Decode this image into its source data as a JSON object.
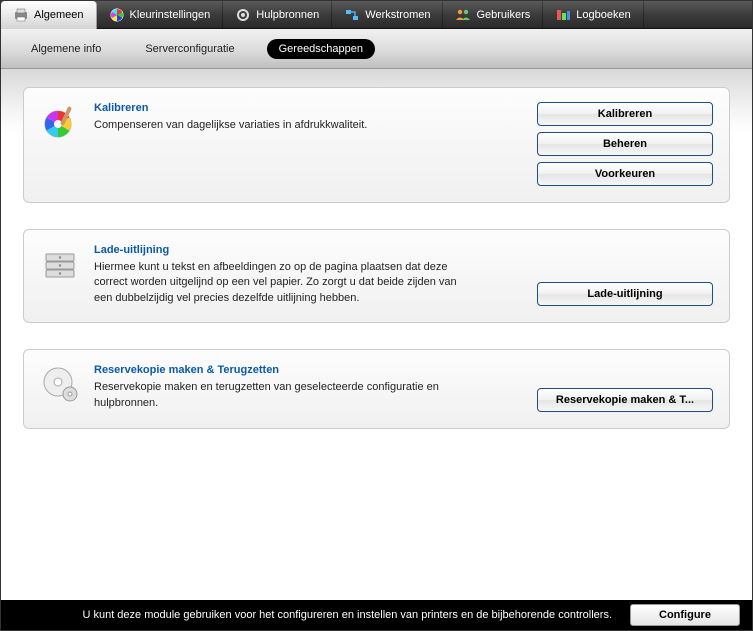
{
  "topTabs": [
    {
      "label": "Algemeen",
      "icon": "printer",
      "active": true
    },
    {
      "label": "Kleurinstellingen",
      "icon": "color-wheel",
      "active": false
    },
    {
      "label": "Hulpbronnen",
      "icon": "gear",
      "active": false
    },
    {
      "label": "Werkstromen",
      "icon": "workflow",
      "active": false
    },
    {
      "label": "Gebruikers",
      "icon": "users",
      "active": false
    },
    {
      "label": "Logboeken",
      "icon": "logs",
      "active": false
    }
  ],
  "subTabs": [
    {
      "label": "Algemene info",
      "active": false
    },
    {
      "label": "Serverconfiguratie",
      "active": false
    },
    {
      "label": "Gereedschappen",
      "active": true
    }
  ],
  "panels": {
    "calibrate": {
      "title": "Kalibreren",
      "desc": "Compenseren van dagelijkse variaties in afdrukkwaliteit.",
      "buttons": {
        "calibrate": "Kalibreren",
        "manage": "Beheren",
        "prefs": "Voorkeuren"
      }
    },
    "tray": {
      "title": "Lade-uitlijning",
      "desc": "Hiermee kunt u tekst en afbeeldingen zo op de pagina plaatsen dat deze correct worden uitgelijnd op een vel papier. Zo zorgt u dat beide zijden van een dubbelzijdig vel precies dezelfde uitlijning hebben.",
      "buttons": {
        "align": "Lade-uitlijning"
      }
    },
    "backup": {
      "title": "Reservekopie maken & Terugzetten",
      "desc": "Reservekopie maken en terugzetten van geselecteerde configuratie en hulpbronnen.",
      "buttons": {
        "backup": "Reservekopie maken & T..."
      }
    }
  },
  "footer": {
    "text": "U kunt deze module gebruiken voor het configureren en instellen van printers en de bijbehorende controllers.",
    "button": "Configure"
  }
}
